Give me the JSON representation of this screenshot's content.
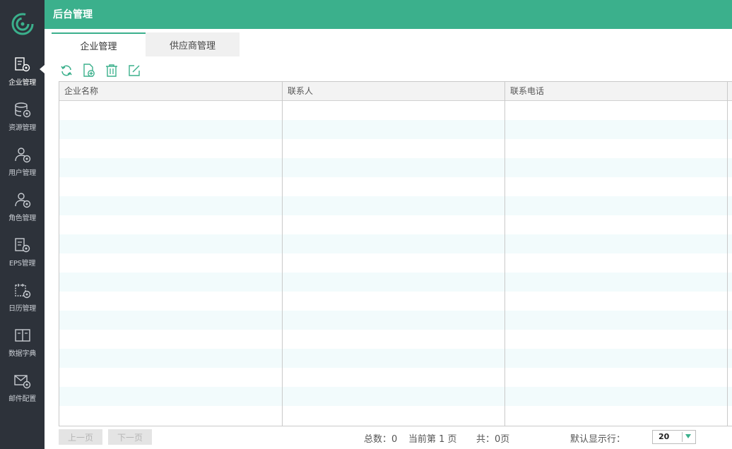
{
  "header": {
    "title": "后台管理"
  },
  "sidebar": {
    "items": [
      {
        "label": "企业管理",
        "icon": "enterprise-settings-icon",
        "active": true
      },
      {
        "label": "资源管理",
        "icon": "database-settings-icon",
        "active": false
      },
      {
        "label": "用户管理",
        "icon": "user-settings-icon",
        "active": false
      },
      {
        "label": "角色管理",
        "icon": "role-settings-icon",
        "active": false
      },
      {
        "label": "EPS管理",
        "icon": "eps-settings-icon",
        "active": false
      },
      {
        "label": "日历管理",
        "icon": "calendar-settings-icon",
        "active": false
      },
      {
        "label": "数据字典",
        "icon": "book-icon",
        "active": false
      },
      {
        "label": "邮件配置",
        "icon": "mail-settings-icon",
        "active": false
      }
    ]
  },
  "tabs": [
    {
      "label": "企业管理",
      "active": true
    },
    {
      "label": "供应商管理",
      "active": false
    }
  ],
  "toolbar": {
    "icons": [
      "refresh-icon",
      "add-document-icon",
      "delete-icon",
      "edit-icon"
    ]
  },
  "table": {
    "columns": [
      "企业名称",
      "联系人",
      "联系电话"
    ],
    "rows": []
  },
  "pager": {
    "prev_label": "上一页",
    "next_label": "下一页",
    "total_text": "总数：0",
    "current_text": "当前第 1 页",
    "pages_text": "共：0页",
    "page_size_label": "默认显示行：",
    "page_size_value": "20"
  },
  "colors": {
    "accent": "#3bb08c",
    "sidebar": "#2d323a",
    "stripe": "#f2fbfc"
  }
}
